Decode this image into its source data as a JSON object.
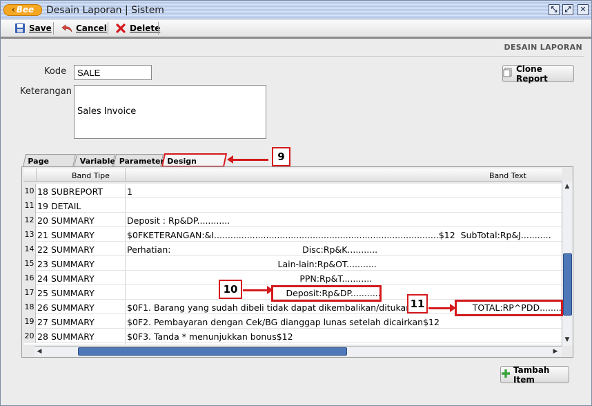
{
  "window": {
    "logo_text": "Bee",
    "title": "Desain Laporan | Sistem",
    "buttons": {
      "restore": "⤡",
      "maximize": "⤢",
      "close": "✕"
    }
  },
  "toolbar": {
    "save_label": "Save",
    "cancel_label": "Cancel",
    "delete_label": "Delete"
  },
  "header": {
    "title": "DESAIN LAPORAN"
  },
  "form": {
    "kode_label": "Kode",
    "kode_value": "SALE",
    "keterangan_label": "Keterangan",
    "keterangan_value": "Sales Invoice",
    "clone_button": "Clone Report"
  },
  "tabs": [
    {
      "label": "Page Setup"
    },
    {
      "label": "Variable"
    },
    {
      "label": "Parameter"
    },
    {
      "label": "Design Layout",
      "active": true
    }
  ],
  "grid": {
    "columns": [
      "Band Tipe",
      "Band Text"
    ],
    "rows": [
      {
        "rownum": "10",
        "no": "18",
        "tipe": "SUBREPORT",
        "text": "1"
      },
      {
        "rownum": "11",
        "no": "19",
        "tipe": "DETAIL",
        "text": ""
      },
      {
        "rownum": "12",
        "no": "20",
        "tipe": "SUMMARY",
        "text": "Deposit : Rp&DP............"
      },
      {
        "rownum": "13",
        "no": "21",
        "tipe": "SUMMARY",
        "text": "$0FKETERANGAN:&I..................................................................................$12  SubTotal:Rp&J..........."
      },
      {
        "rownum": "14",
        "no": "22",
        "tipe": "SUMMARY",
        "text": "Perhatian:                                                Disc:Rp&K..........."
      },
      {
        "rownum": "15",
        "no": "23",
        "tipe": "SUMMARY",
        "text": "                                                       Lain-lain:Rp&OT..........."
      },
      {
        "rownum": "16",
        "no": "24",
        "tipe": "SUMMARY",
        "text": "                                                               PPN:Rp&T..........."
      },
      {
        "rownum": "17",
        "no": "25",
        "tipe": "SUMMARY",
        "text": "                                                          Deposit:Rp&DP..........."
      },
      {
        "rownum": "18",
        "no": "26",
        "tipe": "SUMMARY",
        "text": "$0F1. Barang yang sudah dibeli tidak dapat dikembalikan/ditukar$12                 TOTAL:RP^PDD..........."
      },
      {
        "rownum": "19",
        "no": "27",
        "tipe": "SUMMARY",
        "text": "$0F2. Pembayaran dengan Cek/BG dianggap lunas setelah dicairkan$12"
      },
      {
        "rownum": "20",
        "no": "28",
        "tipe": "SUMMARY",
        "text": "$0F3. Tanda * menunjukkan bonus$12"
      }
    ]
  },
  "add_button": "Tambah Item",
  "callouts": {
    "c9": "9",
    "c10": "10",
    "c11": "11"
  },
  "colors": {
    "accent_red": "#d4191d",
    "title_bar": "#c7d6ef",
    "scroll_thumb": "#4f78b8"
  }
}
